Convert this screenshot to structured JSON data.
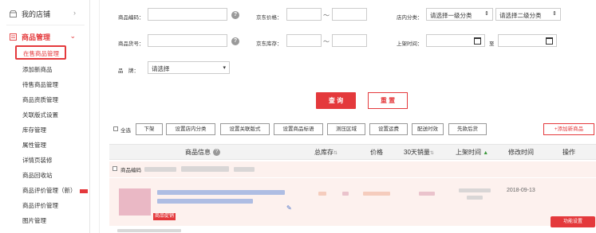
{
  "sidebar": {
    "store": {
      "label": "我的店铺",
      "icon": "store-icon"
    },
    "goods": {
      "label": "商品管理",
      "icon": "goods-management-icon"
    },
    "items": [
      {
        "label": "在售商品管理"
      },
      {
        "label": "添加新商品"
      },
      {
        "label": "待售商品管理"
      },
      {
        "label": "商品资质管理"
      },
      {
        "label": "关联版式设置"
      },
      {
        "label": "库存管理"
      },
      {
        "label": "属性管理"
      },
      {
        "label": "详情页装修"
      },
      {
        "label": "商品回收站"
      },
      {
        "label": "商品评价管理（新）"
      },
      {
        "label": "商品评价管理"
      },
      {
        "label": "图片管理"
      }
    ]
  },
  "filters": {
    "sku_label": "商品编码：",
    "price_label": "京东价格：",
    "category_label": "店内分类：",
    "category1": "请选择一级分类",
    "category2": "请选择二级分类",
    "item_no_label": "商品货号：",
    "stock_label": "京东库存：",
    "listed_time_label": "上架时间：",
    "to_label": "至",
    "brand_label": "品　牌：",
    "brand_select": "请选择",
    "range_sep": "～"
  },
  "actions": {
    "query": "查 询",
    "reset": "重 置"
  },
  "toolbar": {
    "select_all": "全选",
    "buttons": [
      "下架",
      "设置店内分类",
      "设置关联版式",
      "设置商品标语",
      "测压区域",
      "设置运费",
      "配送时效",
      "先款后货"
    ],
    "add_product": "+添加新商品"
  },
  "table": {
    "headers": {
      "info": "商品信息",
      "stock": "总库存",
      "price": "价格",
      "sales30": "30天销量",
      "listed": "上架时间",
      "modified": "修改时间",
      "action": "操作"
    },
    "row": {
      "sku_label": "商品编码",
      "tag": "商品促销",
      "date": "2018-09-13",
      "func_button": "功能设置"
    }
  }
}
